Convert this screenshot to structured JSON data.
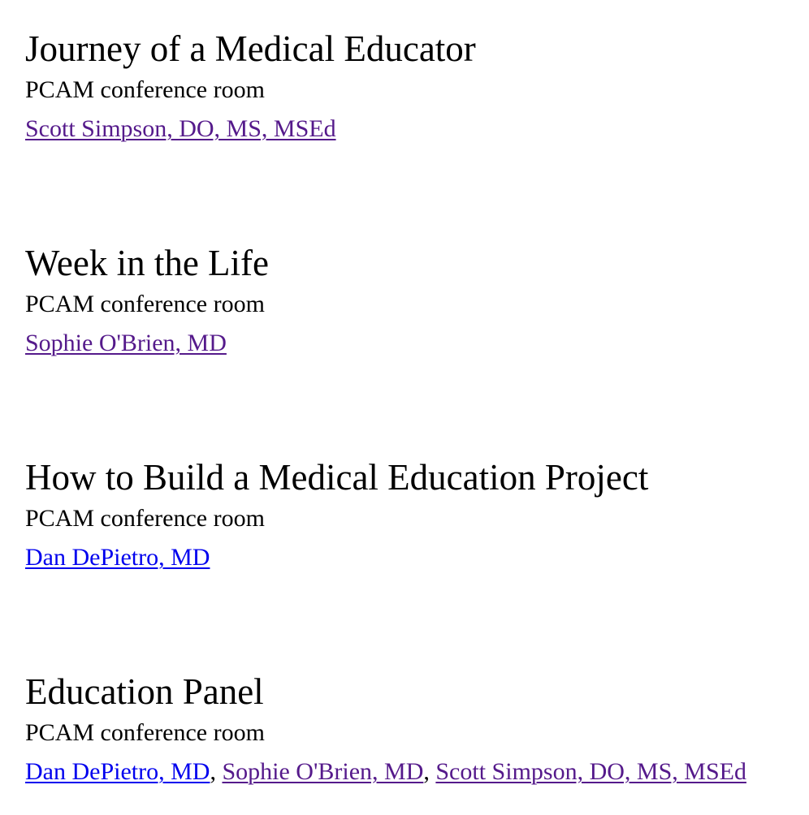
{
  "colors": {
    "text": "#000000",
    "background": "#ffffff",
    "link_visited": "#551a8b",
    "link_unvisited": "#0000ee"
  },
  "sessions": [
    {
      "title": "Journey of a Medical Educator",
      "location": "PCAM conference room",
      "speakers": [
        {
          "name": "Scott Simpson, DO, MS, MSEd",
          "visited": true
        }
      ]
    },
    {
      "title": "Week in the Life",
      "location": "PCAM conference room",
      "speakers": [
        {
          "name": "Sophie O'Brien, MD",
          "visited": true
        }
      ]
    },
    {
      "title": "How to Build a Medical Education Project",
      "location": "PCAM conference room",
      "speakers": [
        {
          "name": "Dan DePietro, MD",
          "visited": false
        }
      ]
    },
    {
      "title": "Education Panel",
      "location": "PCAM conference room",
      "speakers": [
        {
          "name": "Dan DePietro, MD",
          "visited": false
        },
        {
          "name": "Sophie O'Brien, MD",
          "visited": true
        },
        {
          "name": "Scott Simpson, DO, MS, MSEd",
          "visited": true
        }
      ],
      "separator": ", "
    }
  ]
}
